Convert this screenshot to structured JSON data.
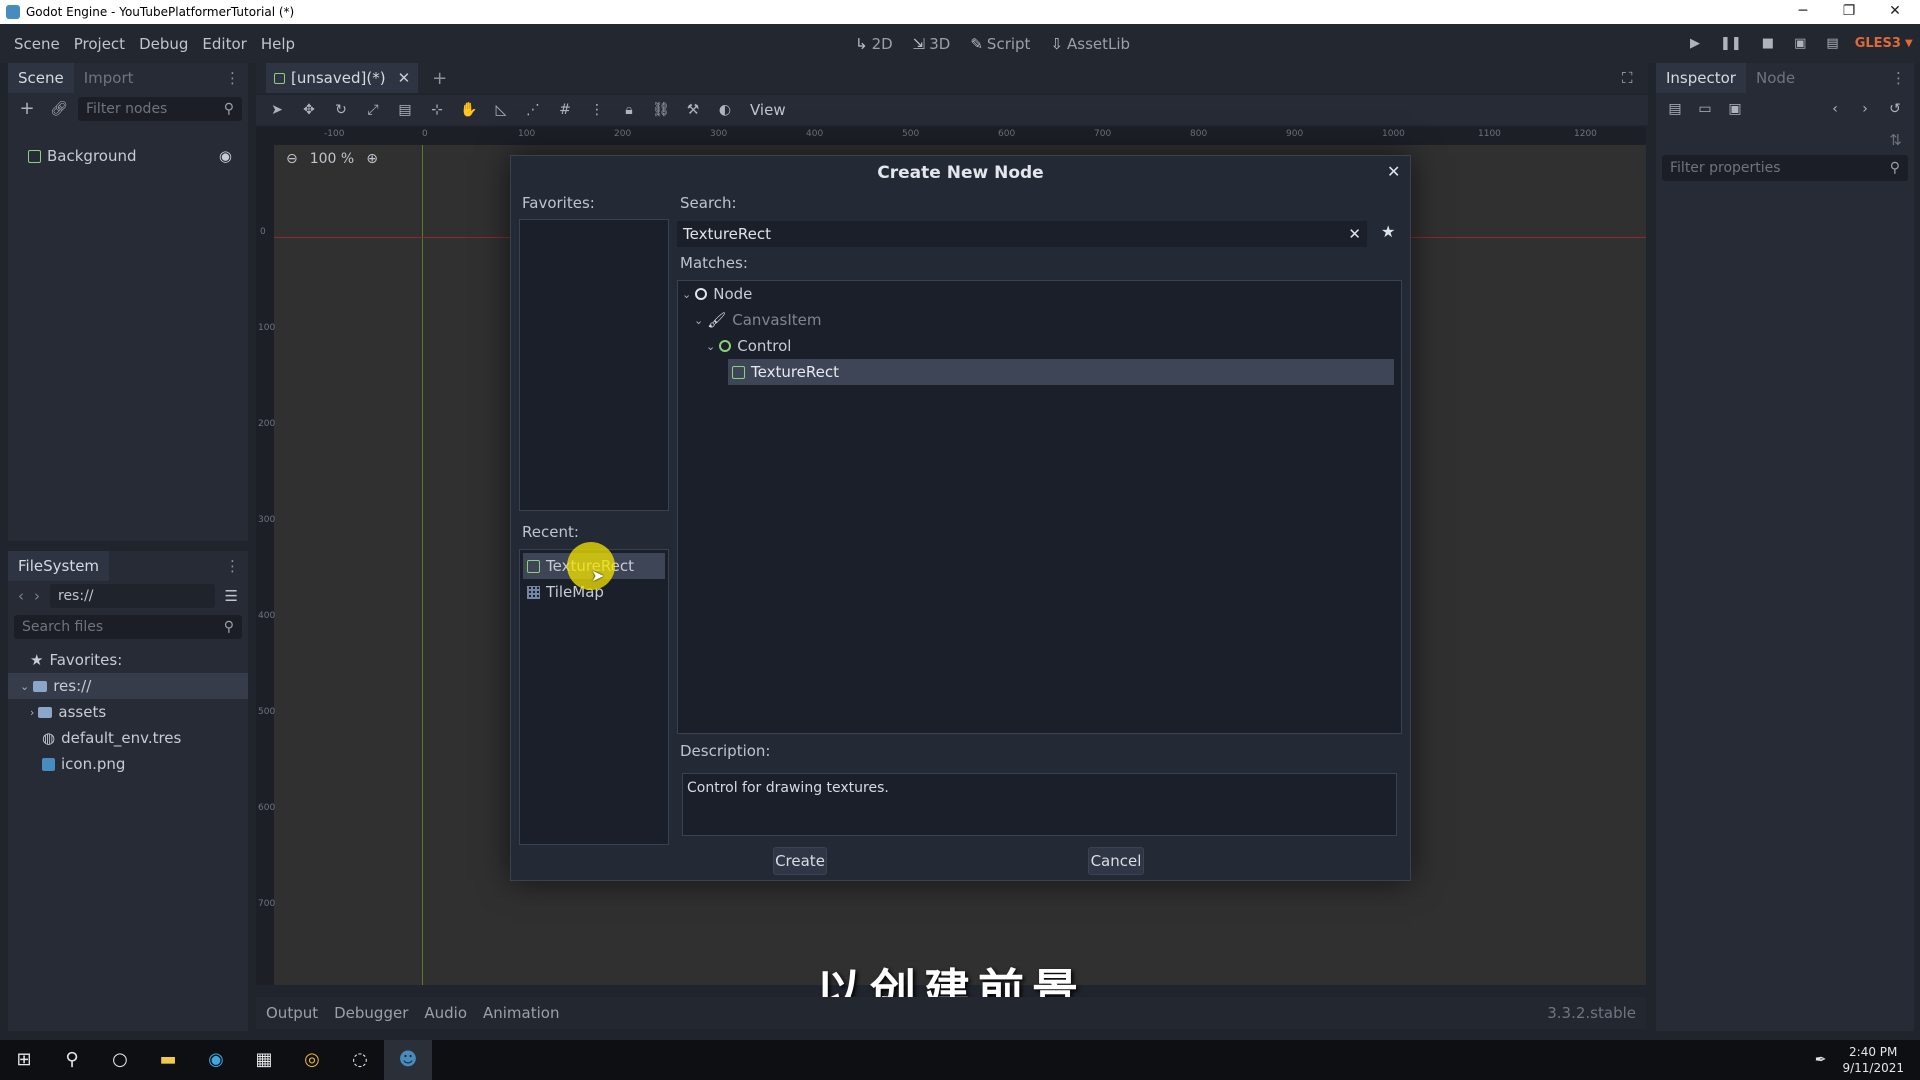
{
  "window": {
    "title": "Godot Engine - YouTubePlatformerTutorial (*)",
    "controls": [
      "─",
      "❐",
      "✕"
    ]
  },
  "menu": {
    "items": [
      "Scene",
      "Project",
      "Debug",
      "Editor",
      "Help"
    ]
  },
  "workspaces": [
    {
      "icon": "↳",
      "label": "2D"
    },
    {
      "icon": "⇲",
      "label": "3D"
    },
    {
      "icon": "✎",
      "label": "Script"
    },
    {
      "icon": "⇩",
      "label": "AssetLib"
    }
  ],
  "renderer": "GLES3",
  "scene_dock": {
    "tabs": [
      "Scene",
      "Import"
    ],
    "filter_placeholder": "Filter nodes",
    "nodes": [
      {
        "label": "Background"
      }
    ]
  },
  "filesystem": {
    "title": "FileSystem",
    "path": "res://",
    "search_placeholder": "Search files",
    "items": [
      "Favorites:",
      "res://",
      "assets",
      "default_env.tres",
      "icon.png"
    ]
  },
  "editor": {
    "tab_label": "[unsaved](*)",
    "view_label": "View",
    "zoom": "100 %",
    "ruler_ticks": [
      "-100",
      "0",
      "100",
      "200",
      "300",
      "400",
      "500",
      "600",
      "700",
      "800",
      "900",
      "1000",
      "1100",
      "1200"
    ],
    "vruler_ticks": [
      "0",
      "100",
      "200",
      "300",
      "400",
      "500",
      "600",
      "700"
    ]
  },
  "inspector": {
    "tabs": [
      "Inspector",
      "Node"
    ],
    "filter_placeholder": "Filter properties"
  },
  "bottom": {
    "tabs": [
      "Output",
      "Debugger",
      "Audio",
      "Animation"
    ],
    "version": "3.3.2.stable"
  },
  "dialog": {
    "title": "Create New Node",
    "favorites_label": "Favorites:",
    "search_label": "Search:",
    "search_value": "TextureRect",
    "matches_label": "Matches:",
    "tree": [
      "Node",
      "CanvasItem",
      "Control",
      "TextureRect"
    ],
    "recent_label": "Recent:",
    "recent": [
      "TextureRect",
      "TileMap"
    ],
    "description_label": "Description:",
    "description": "Control for drawing textures.",
    "create_label": "Create",
    "cancel_label": "Cancel"
  },
  "subtitle": "以创建前景",
  "taskbar": {
    "time": "2:40 PM",
    "date": "9/11/2021"
  },
  "colors": {
    "accent": "#8ed07a",
    "selection": "#3e4556",
    "highlight": "#f5e600"
  }
}
